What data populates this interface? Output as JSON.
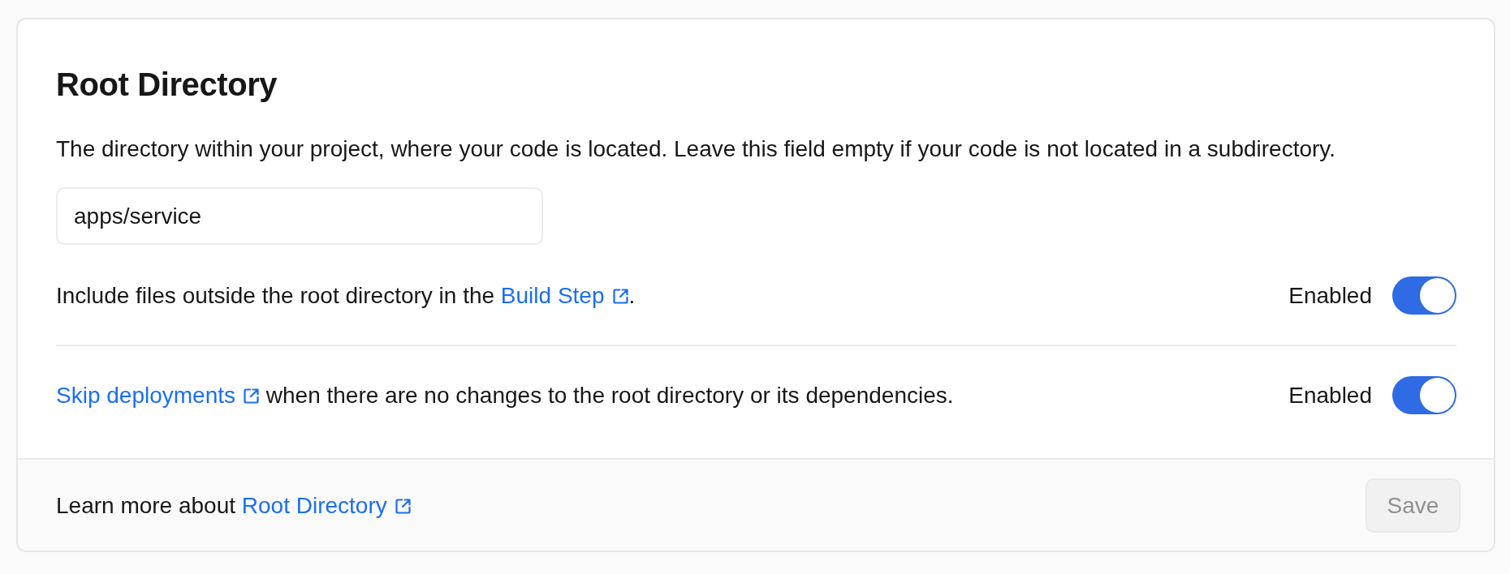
{
  "section": {
    "title": "Root Directory",
    "description": "The directory within your project, where your code is located. Leave this field empty if your code is not located in a subdirectory.",
    "field": {
      "value": "apps/service"
    }
  },
  "settings": [
    {
      "parts": [
        {
          "kind": "text",
          "text": "Include files outside the root directory in the "
        },
        {
          "kind": "link",
          "text": "Build Step"
        },
        {
          "kind": "text",
          "text": "."
        }
      ],
      "status": "Enabled",
      "on": true
    },
    {
      "parts": [
        {
          "kind": "link",
          "text": "Skip deployments"
        },
        {
          "kind": "text",
          "text": " when there are no changes to the root directory or its dependencies."
        }
      ],
      "status": "Enabled",
      "on": true
    }
  ],
  "footer": {
    "parts": [
      {
        "kind": "text",
        "text": "Learn more about "
      },
      {
        "kind": "link",
        "text": "Root Directory"
      }
    ],
    "save_button": {
      "label": "Save",
      "disabled": true
    }
  }
}
